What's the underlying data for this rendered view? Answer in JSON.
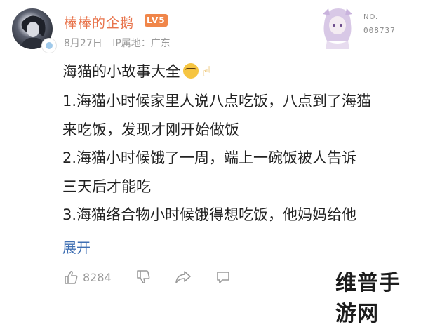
{
  "post": {
    "author": {
      "name": "棒棒的企鹅",
      "level": "LV5"
    },
    "meta": {
      "date": "8月27日",
      "location": "IP属地：广东"
    },
    "decoration": {
      "no_label": "NO.",
      "number": "008737"
    },
    "title": "海猫的小故事大全",
    "title_emojis": [
      "nerd-face-icon",
      "pointing-up-icon"
    ],
    "lines": [
      "1.海猫小时候家里人说八点吃饭，八点到了海猫",
      "来吃饭，发现才刚开始做饭",
      "2.海猫小时候饿了一周，端上一碗饭被人告诉",
      "三天后才能吃",
      "3.海猫络合物小时候饿得想吃饭，他妈妈给他"
    ],
    "expand_label": "展开"
  },
  "actions": {
    "like_count": "8284",
    "icons": [
      "like-icon",
      "dislike-icon",
      "share-icon",
      "comment-icon"
    ]
  },
  "watermark": "维普手游网",
  "colors": {
    "username": "#e8744c",
    "level_badge": "#f0864a",
    "link": "#3f6fb3",
    "meta": "#9a9a9a"
  }
}
